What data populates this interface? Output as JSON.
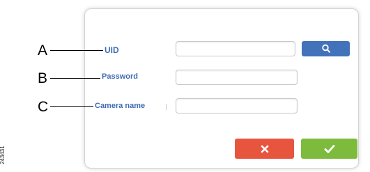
{
  "dialog": {
    "uid": {
      "label": "UID",
      "value": ""
    },
    "password": {
      "label": "Password",
      "value": ""
    },
    "camera_name": {
      "label": "Camera name",
      "value": ""
    },
    "search_button": {
      "icon": "search-icon"
    },
    "cancel_button": {
      "icon": "close-icon"
    },
    "ok_button": {
      "icon": "checkmark-icon"
    }
  },
  "callouts": {
    "a": "A",
    "b": "B",
    "c": "C"
  },
  "figure_id": "243431",
  "colors": {
    "label": "#3f6cb3",
    "search": "#4272ba",
    "cancel": "#e8553f",
    "ok": "#7dbb3c"
  }
}
